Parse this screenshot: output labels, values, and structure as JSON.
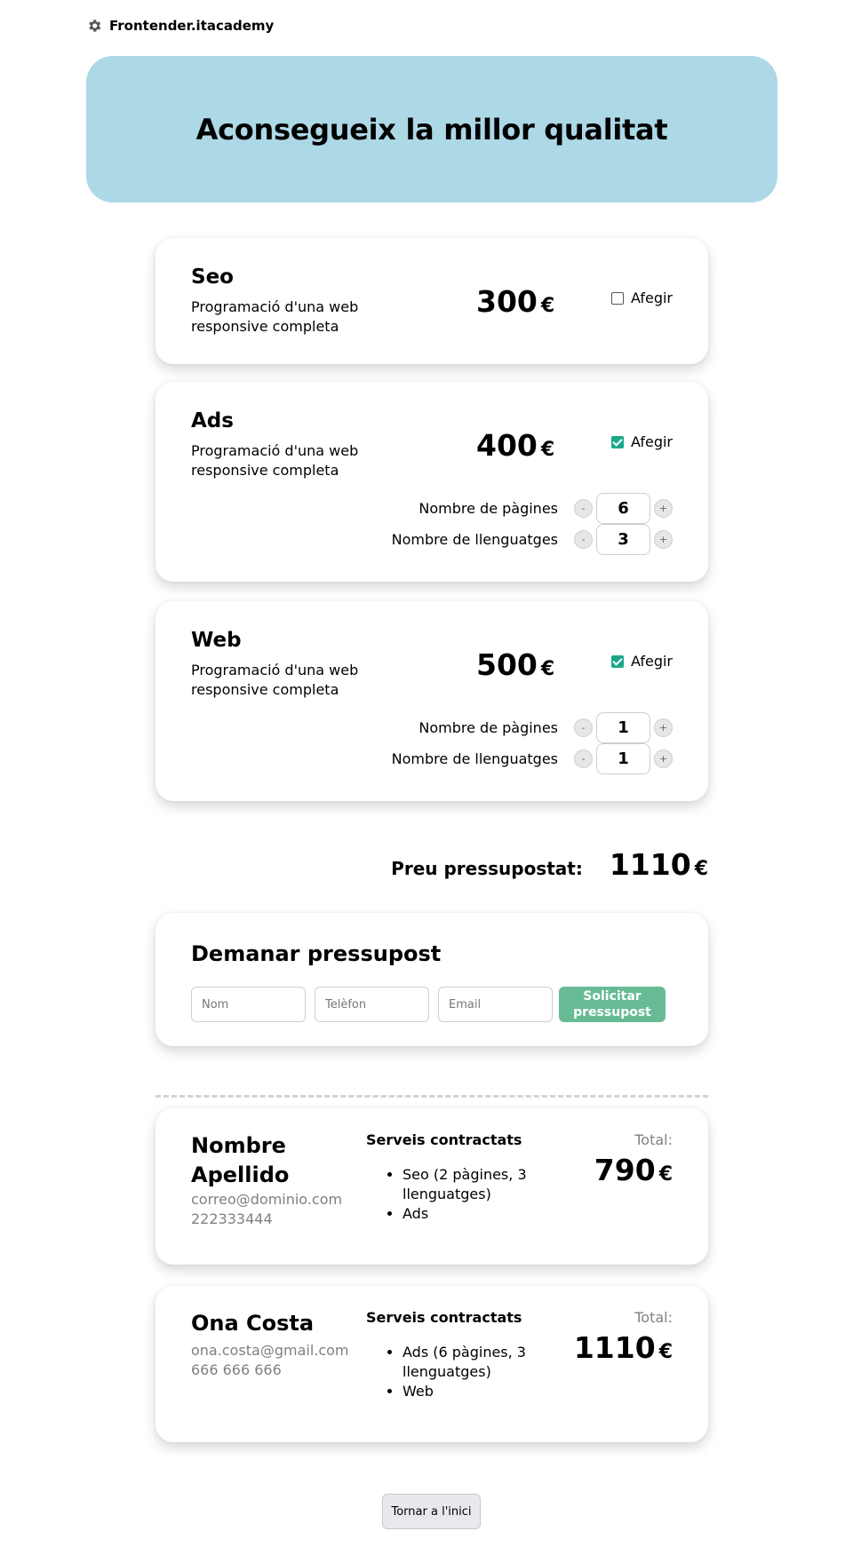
{
  "brand": {
    "icon": "gear-icon",
    "name": "Frontender.itacademy"
  },
  "hero": {
    "title": "Aconsegueix la millor qualitat"
  },
  "currency": "€",
  "services": [
    {
      "name": "Seo",
      "description": "Programació d'una web responsive completa",
      "price": "300",
      "add_label": "Afegir",
      "checked": false
    },
    {
      "name": "Ads",
      "description": "Programació d'una web responsive completa",
      "price": "400",
      "add_label": "Afegir",
      "checked": true,
      "options": {
        "pages_label": "Nombre de pàgines",
        "pages": "6",
        "languages_label": "Nombre de llenguatges",
        "languages": "3"
      }
    },
    {
      "name": "Web",
      "description": "Programació d'una web responsive completa",
      "price": "500",
      "add_label": "Afegir",
      "checked": true,
      "options": {
        "pages_label": "Nombre de pàgines",
        "pages": "1",
        "languages_label": "Nombre de llenguatges",
        "languages": "1"
      }
    }
  ],
  "stepper": {
    "minus": "-",
    "plus": "+"
  },
  "total": {
    "label": "Preu pressupostat:",
    "value": "1110"
  },
  "request_form": {
    "title": "Demanar pressupost",
    "name_placeholder": "Nom",
    "phone_placeholder": "Telèfon",
    "email_placeholder": "Email",
    "submit_label": "Solicitar pressupost"
  },
  "budgets": [
    {
      "name": "Nombre Apellido",
      "email": "correo@dominio.com",
      "phone": "222333444",
      "services_title": "Serveis contractats",
      "services": [
        "Seo (2 pàgines, 3 llenguatges)",
        "Ads"
      ],
      "total_label": "Total:",
      "total": "790"
    },
    {
      "name": "Ona Costa",
      "email": "ona.costa@gmail.com",
      "phone": "666 666 666",
      "services_title": "Serveis contractats",
      "services": [
        "Ads (6 pàgines, 3 llenguatges)",
        "Web"
      ],
      "total_label": "Total:",
      "total": "1110"
    }
  ],
  "back_button": "Tornar a l'inici"
}
